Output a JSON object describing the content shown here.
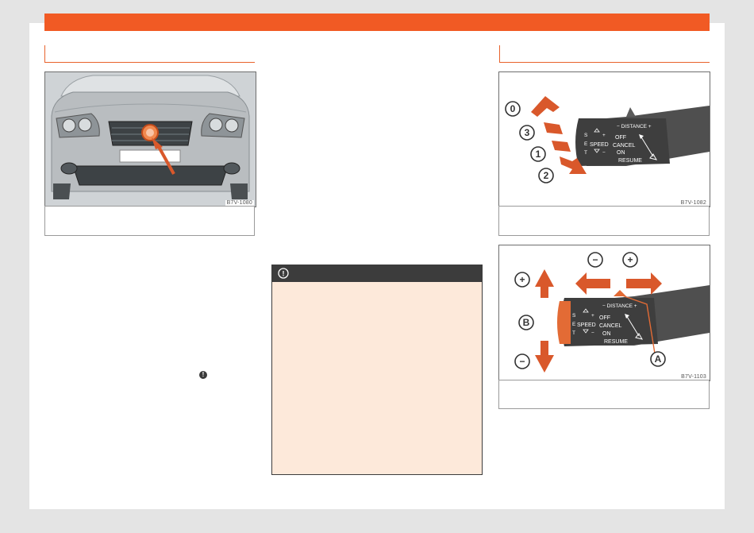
{
  "figures": {
    "front": {
      "code": "B7V-1080"
    },
    "lever": {
      "code": "B7V-1082",
      "badges": [
        "0",
        "3",
        "1",
        "2"
      ],
      "distance_label": "− DISTANCE +",
      "side_letters": [
        "S",
        "E",
        "T"
      ],
      "speed_label": "SPEED",
      "plus_sign": "+",
      "minus_sign": "−",
      "labels": [
        "OFF",
        "CANCEL",
        "ON",
        "RESUME"
      ]
    },
    "controls": {
      "code": "B7V-1103",
      "badges": [
        "−",
        "+",
        "+",
        "B",
        "−",
        "A"
      ],
      "distance_label": "− DISTANCE +",
      "side_letters": [
        "S",
        "E",
        "T"
      ],
      "speed_label": "SPEED",
      "plus_sign": "+",
      "minus_sign": "−",
      "labels": [
        "OFF",
        "CANCEL",
        "ON",
        "RESUME"
      ]
    }
  },
  "warning": {
    "icon": "exclamation-circle-icon",
    "symbol": "!"
  },
  "note_icon": {
    "icon": "exclamation-dot-icon",
    "symbol": "!"
  },
  "colors": {
    "accent": "#f15a24",
    "warning_body": "#fde9da",
    "arrow": "#d9582b"
  }
}
